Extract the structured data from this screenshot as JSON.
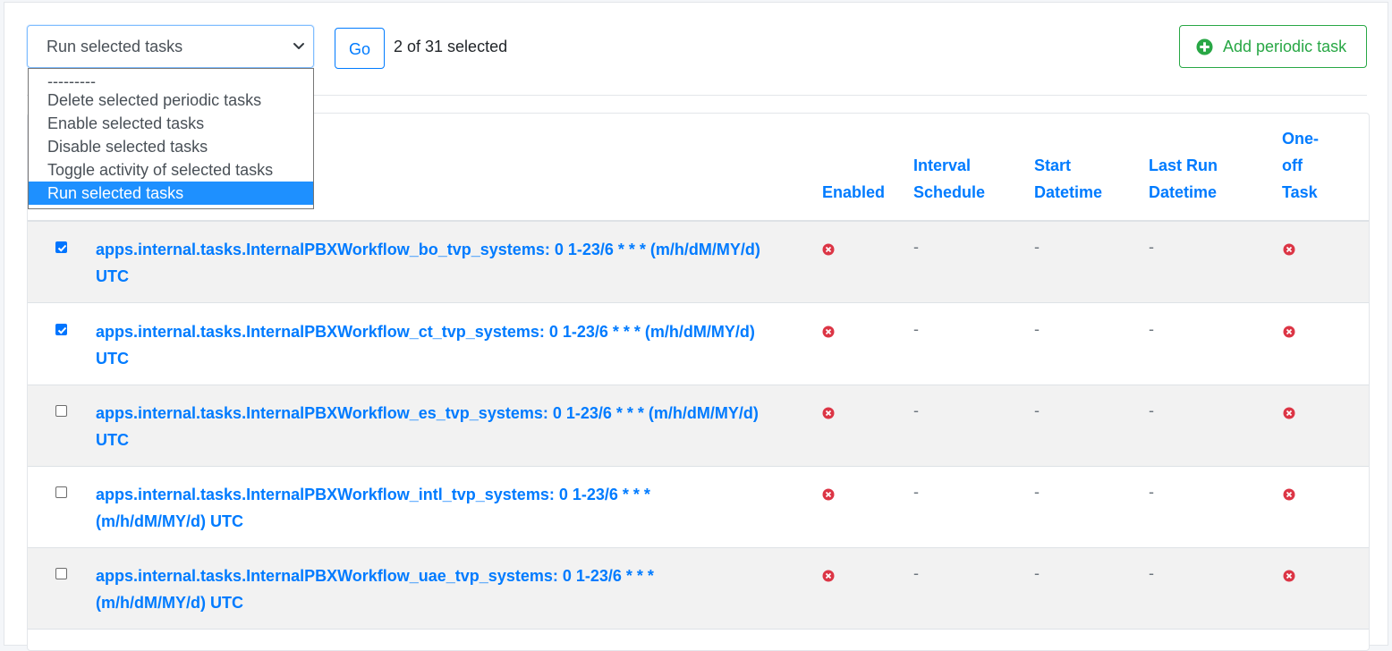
{
  "actions": {
    "select_value": "Run selected tasks",
    "options": [
      "---------",
      "Delete selected periodic tasks",
      "Enable selected tasks",
      "Disable selected tasks",
      "Toggle activity of selected tasks",
      "Run selected tasks"
    ],
    "selected_index": 5,
    "go_label": "Go",
    "selection_count": "2 of 31 selected"
  },
  "add_button": {
    "label": "Add periodic task"
  },
  "table": {
    "headers": {
      "enabled": "Enabled",
      "interval_schedule_1": "Interval",
      "interval_schedule_2": "Schedule",
      "start_datetime_1": "Start",
      "start_datetime_2": "Datetime",
      "last_run_1": "Last Run",
      "last_run_2": "Datetime",
      "one_off_1": "One-",
      "one_off_2": "off",
      "one_off_3": "Task"
    },
    "rows": [
      {
        "checked": true,
        "name_line1": "apps.internal.tasks.InternalPBXWorkflow_bo_tvp_systems: 0 1-23/6 * * * (m/h/dM/MY/d)",
        "name_line2": "UTC",
        "enabled": false,
        "interval": "-",
        "start": "-",
        "last_run": "-",
        "one_off": false
      },
      {
        "checked": true,
        "name_line1": "apps.internal.tasks.InternalPBXWorkflow_ct_tvp_systems: 0 1-23/6 * * * (m/h/dM/MY/d)",
        "name_line2": "UTC",
        "enabled": false,
        "interval": "-",
        "start": "-",
        "last_run": "-",
        "one_off": false
      },
      {
        "checked": false,
        "name_line1": "apps.internal.tasks.InternalPBXWorkflow_es_tvp_systems: 0 1-23/6 * * * (m/h/dM/MY/d)",
        "name_line2": "UTC",
        "enabled": false,
        "interval": "-",
        "start": "-",
        "last_run": "-",
        "one_off": false
      },
      {
        "checked": false,
        "name_line1": "apps.internal.tasks.InternalPBXWorkflow_intl_tvp_systems: 0 1-23/6 * * *",
        "name_line2": "(m/h/dM/MY/d) UTC",
        "enabled": false,
        "interval": "-",
        "start": "-",
        "last_run": "-",
        "one_off": false
      },
      {
        "checked": false,
        "name_line1": "apps.internal.tasks.InternalPBXWorkflow_uae_tvp_systems: 0 1-23/6 * * *",
        "name_line2": "(m/h/dM/MY/d) UTC",
        "enabled": false,
        "interval": "-",
        "start": "-",
        "last_run": "-",
        "one_off": false
      }
    ]
  },
  "colors": {
    "link": "#007bff",
    "success": "#28a745",
    "danger": "#dc3545",
    "highlight": "#1e90ff"
  },
  "icons": {
    "add": "plus-circle-icon",
    "false": "x-circle-icon",
    "select": "chevron-down-icon",
    "checkbox": "check-icon"
  }
}
